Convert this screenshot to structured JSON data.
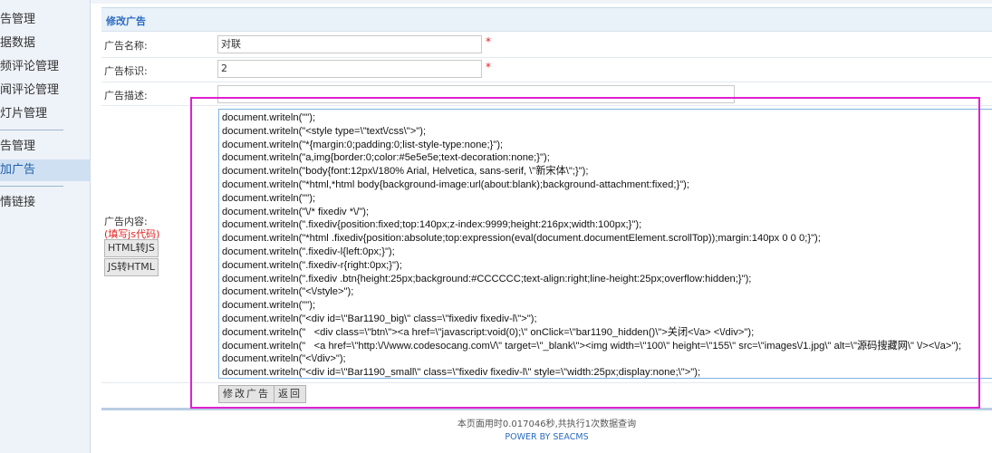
{
  "sidebar": {
    "items": [
      {
        "label": "告管理"
      },
      {
        "label": "据数据"
      },
      {
        "label": "频评论管理"
      },
      {
        "label": "闻评论管理"
      },
      {
        "label": "灯片管理"
      },
      {
        "label": "告管理"
      },
      {
        "label": "加广告"
      },
      {
        "label": "情链接"
      }
    ]
  },
  "panel": {
    "title": "修改广告",
    "name_label": "广告名称:",
    "name_value": "对联",
    "id_label": "广告标识:",
    "id_value": "2",
    "desc_label": "广告描述:",
    "desc_value": "",
    "content_label": "广告内容:",
    "content_hint": "(填写js代码)",
    "html_to_js_label": "HTML转JS",
    "js_to_html_label": "JS转HTML",
    "required_mark": "*",
    "code_lines": [
      "document.writeln(\"\");",
      "document.writeln(\"<style type=\\\"text\\/css\\\">\");",
      "document.writeln(\"*{margin:0;padding:0;list-style-type:none;}\");",
      "document.writeln(\"a,img{border:0;color:#5e5e5e;text-decoration:none;}\");",
      "document.writeln(\"body{font:12px\\/180% Arial, Helvetica, sans-serif, \\\"新宋体\\\";}\");",
      "document.writeln(\"*html,*html body{background-image:url(about:blank);background-attachment:fixed;}\");",
      "document.writeln(\"\");",
      "document.writeln(\"\\/* fixediv *\\/\");",
      "document.writeln(\".fixediv{position:fixed;top:140px;z-index:9999;height:216px;width:100px;}\");",
      "document.writeln(\"*html .fixediv{position:absolute;top:expression(eval(document.documentElement.scrollTop));margin:140px 0 0 0;}\");",
      "document.writeln(\".fixediv-l{left:0px;}\");",
      "document.writeln(\".fixediv-r{right:0px;}\");",
      "document.writeln(\".fixediv .btn{height:25px;background:#CCCCCC;text-align:right;line-height:25px;overflow:hidden;}\");",
      "document.writeln(\"<\\/style>\");",
      "document.writeln(\"\");",
      "document.writeln(\"<div id=\\\"Bar1190_big\\\" class=\\\"fixediv fixediv-l\\\">\");",
      "document.writeln(\"   <div class=\\\"btn\\\"><a href=\\\"javascript:void(0);\\\" onClick=\\\"bar1190_hidden()\\\">关闭<\\/a> <\\/div>\");",
      "document.writeln(\"   <a href=\\\"http:\\/\\/www.codesocang.com\\/\\\" target=\\\"_blank\\\"><img width=\\\"100\\\" height=\\\"155\\\" src=\\\"images\\/1.jpg\\\" alt=\\\"源码搜藏网\\\" \\/><\\/a>\");",
      "document.writeln(\"<\\/div>\");",
      "document.writeln(\"<div id=\\\"Bar1190_small\\\" class=\\\"fixediv fixediv-l\\\" style=\\\"width:25px;display:none;\\\">\");"
    ],
    "submit_label": "修改广告",
    "back_label": "返回"
  },
  "footer": {
    "stats": "本页面用时0.017046秒,共执行1次数据查询",
    "powered": "POWER BY SEACMS"
  },
  "colors": {
    "accent": "#2a6bbf",
    "highlight_box": "#e020d0",
    "required": "#e02020"
  }
}
